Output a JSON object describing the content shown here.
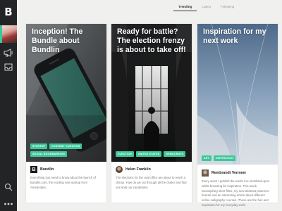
{
  "app": {
    "logo": "B"
  },
  "sidebar": {
    "icons": [
      "megaphone-icon",
      "inbox-icon",
      "search-icon",
      "more-icon"
    ]
  },
  "tabs": [
    "Trending",
    "Latest",
    "Following"
  ],
  "cards": [
    {
      "title": "Inception! The Bundle about Bundlin",
      "tags": [
        "STARTUP",
        "CONTENT CURATION",
        "SOCIAL BOOKMARKING"
      ],
      "author": "Bundlin",
      "description": "Everything you need to know about the launch of Bundlin.com, the exciting new startup from Amsterdam."
    },
    {
      "title": "Ready for battle? The election frenzy is about to take off!",
      "tags": [
        "ELECTION",
        "UNITED STATES",
        "DEMOCRATS"
      ],
      "author": "Helen Franklin",
      "description": "The elections for the oval office are about to reach a climax. How do we cut through all the clutter and find out what our candidates"
    },
    {
      "title": "Inspiration for my next work",
      "tags": [
        "ART",
        "INSPIRATION"
      ],
      "author": "Rembrandt Vermeer",
      "description": "Every week I publish the works I've stumbled upon whilst browsing for inspiration. This week, twoinspiring short films, my new abstract pinterest boards and an interesting article about different online calligraphy courses. These are the fuel and inspiration for my everyday work."
    }
  ]
}
